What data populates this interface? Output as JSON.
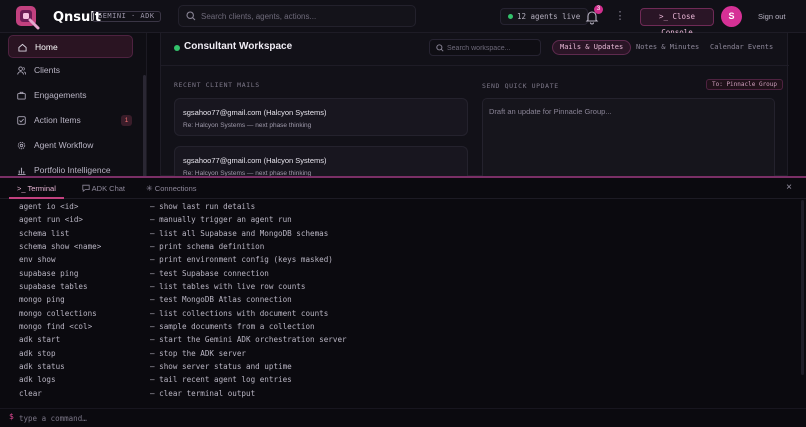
{
  "app": {
    "brand": "Qnsult",
    "badge": "GEMINI · ADK",
    "logo_icon": "q-logo-icon",
    "accent": "#d63196"
  },
  "topbar": {
    "search_placeholder": "Search clients, agents, actions...",
    "agents_live": "12 agents live",
    "notifications_count": "3",
    "close_console_label": "Close Console",
    "avatar_initial": "S",
    "signout_label": "Sign out"
  },
  "sidebar": {
    "items": [
      {
        "label": "Home",
        "icon": "home-icon",
        "active": true
      },
      {
        "label": "Clients",
        "icon": "users-icon"
      },
      {
        "label": "Engagements",
        "icon": "briefcase-icon"
      },
      {
        "label": "Action Items",
        "icon": "checkbox-icon",
        "badge": "1"
      },
      {
        "label": "Agent Workflow",
        "icon": "gear-icon"
      },
      {
        "label": "Portfolio Intelligence",
        "icon": "bar-chart-icon"
      }
    ]
  },
  "workspace": {
    "title": "Consultant Workspace",
    "search_placeholder": "Search workspace...",
    "tabs": [
      "Mails & Updates",
      "Notes & Minutes",
      "Calendar Events"
    ],
    "active_tab": "Mails & Updates",
    "recent_label": "RECENT CLIENT MAILS",
    "quick_label": "SEND QUICK UPDATE",
    "to_label": "To: Pinnacle Group",
    "draft_placeholder": "Draft an update for Pinnacle Group...",
    "mails": [
      {
        "from": "sgsahoo77@gmail.com (Halcyon Systems)",
        "subject": "Re: Halcyon Systems — next phase thinking"
      },
      {
        "from": "sgsahoo77@gmail.com (Halcyon Systems)",
        "subject": "Re: Halcyon Systems — next phase thinking"
      }
    ]
  },
  "terminal": {
    "tabs": [
      {
        "label": "Terminal",
        "icon": "terminal-icon",
        "active": true
      },
      {
        "label": "ADK Chat",
        "icon": "chat-icon"
      },
      {
        "label": "Connections",
        "icon": "connections-icon"
      }
    ],
    "lines": [
      {
        "cmd": "agent io <id>",
        "desc": "— show last run details"
      },
      {
        "cmd": "agent run <id>",
        "desc": "— manually trigger an agent run"
      },
      {
        "cmd": "schema list",
        "desc": "— list all Supabase and MongoDB schemas"
      },
      {
        "cmd": "schema show <name>",
        "desc": "— print schema definition"
      },
      {
        "cmd": "env show",
        "desc": "— print environment config (keys masked)"
      },
      {
        "cmd": "supabase ping",
        "desc": "— test Supabase connection"
      },
      {
        "cmd": "supabase tables",
        "desc": "— list tables with live row counts"
      },
      {
        "cmd": "mongo ping",
        "desc": "— test MongoDB Atlas connection"
      },
      {
        "cmd": "mongo collections",
        "desc": "— list collections with document counts"
      },
      {
        "cmd": "mongo find <col>",
        "desc": "— sample documents from a collection"
      },
      {
        "cmd": "adk start",
        "desc": "— start the Gemini ADK orchestration server"
      },
      {
        "cmd": "adk stop",
        "desc": "— stop the ADK server"
      },
      {
        "cmd": "adk status",
        "desc": "— show server status and uptime"
      },
      {
        "cmd": "adk logs",
        "desc": "— tail recent agent log entries"
      },
      {
        "cmd": "clear",
        "desc": "— clear terminal output"
      }
    ],
    "prompt": "$",
    "input_placeholder": "type a command…"
  }
}
